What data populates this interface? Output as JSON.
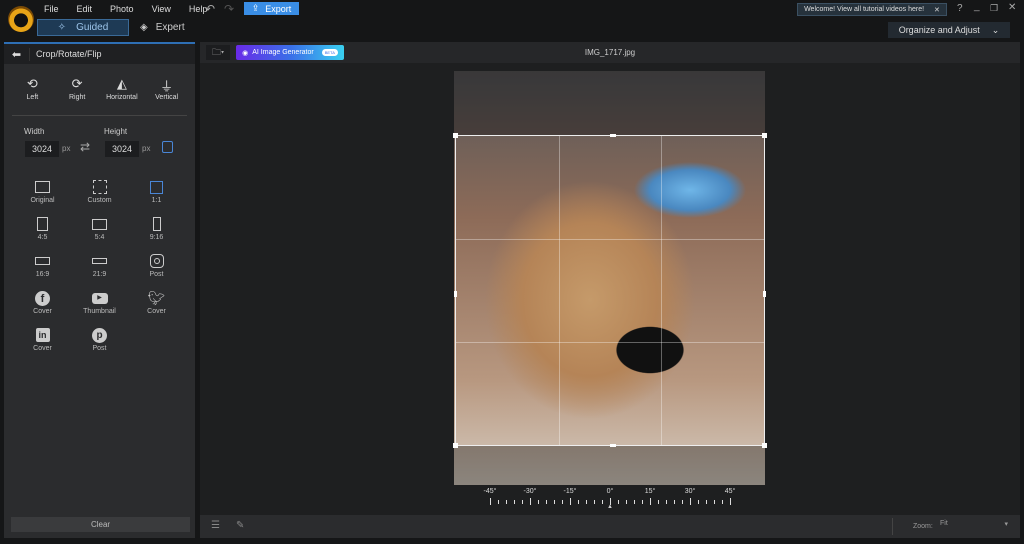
{
  "menu": [
    "File",
    "Edit",
    "Photo",
    "View",
    "Help"
  ],
  "export_label": "Export",
  "modes": {
    "guided": "Guided",
    "expert": "Expert"
  },
  "tooltip": "Welcome! View all tutorial videos here!",
  "workspace": "Organize and Adjust",
  "panel": {
    "title": "Crop/Rotate/Flip",
    "tools": [
      {
        "label": "Left",
        "icon": "rotate-left-icon"
      },
      {
        "label": "Right",
        "icon": "rotate-right-icon"
      },
      {
        "label": "Horizontal",
        "icon": "flip-horizontal-icon"
      },
      {
        "label": "Vertical",
        "icon": "flip-vertical-icon"
      }
    ],
    "width_label": "Width",
    "height_label": "Height",
    "width": "3024",
    "height": "3024",
    "unit": "px",
    "presets": [
      {
        "label": "Original"
      },
      {
        "label": "Custom"
      },
      {
        "label": "1:1",
        "selected": true
      },
      {
        "label": "4:5"
      },
      {
        "label": "5:4"
      },
      {
        "label": "9:16"
      },
      {
        "label": "16:9"
      },
      {
        "label": "21:9"
      },
      {
        "label": "Post"
      },
      {
        "label": "Cover"
      },
      {
        "label": "Thumbnail"
      },
      {
        "label": "Cover"
      },
      {
        "label": "Cover"
      },
      {
        "label": "Post"
      }
    ],
    "clear": "Clear"
  },
  "ai_label": "AI Image Generator",
  "beta": "BETA",
  "filename": "IMG_1717.jpg",
  "ruler": [
    "-45°",
    "-30°",
    "-15°",
    "0°",
    "15°",
    "30°",
    "45°"
  ],
  "rotation_deg": 0,
  "zoom_label": "Zoom:",
  "zoom_value": "Fit",
  "colors": {
    "accent": "#3a8ee6",
    "selected": "#4a86d6"
  }
}
